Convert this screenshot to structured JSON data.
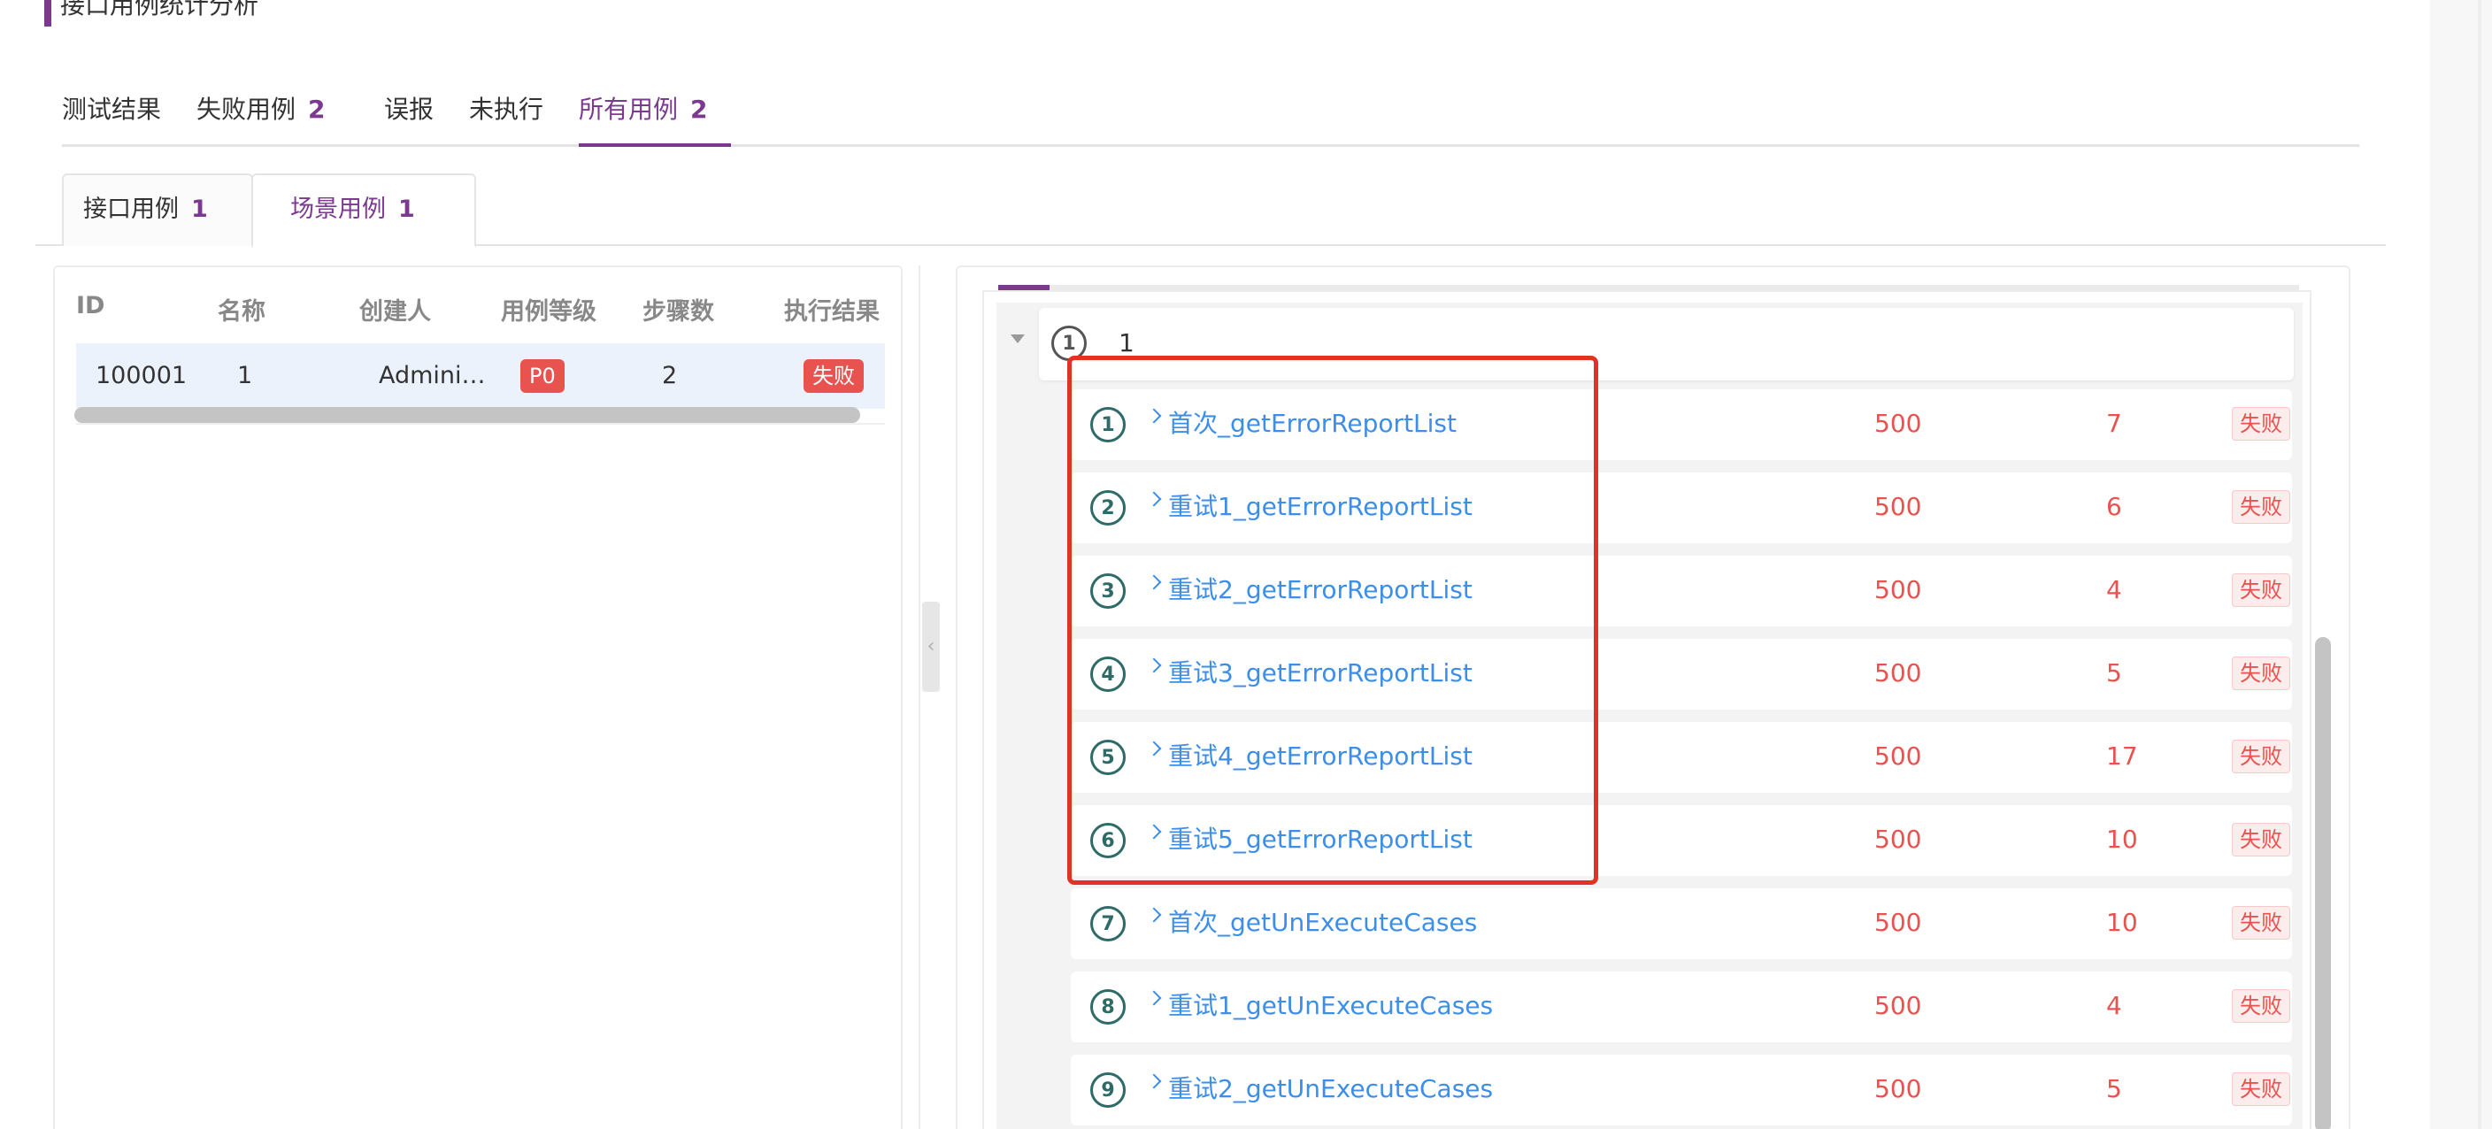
{
  "page": {
    "title": "接口用例统计分析"
  },
  "top_tabs": [
    {
      "label": "测试结果",
      "count": ""
    },
    {
      "label": "失败用例",
      "count": "2"
    },
    {
      "label": "误报",
      "count": ""
    },
    {
      "label": "未执行",
      "count": ""
    },
    {
      "label": "所有用例",
      "count": "2",
      "active": true
    }
  ],
  "sub_tabs": [
    {
      "label": "接口用例",
      "count": "1"
    },
    {
      "label": "场景用例",
      "count": "1",
      "active": true
    }
  ],
  "left_table": {
    "headers": [
      "ID",
      "名称",
      "创建人",
      "用例等级",
      "步骤数",
      "执行结果"
    ],
    "rows": [
      {
        "id": "100001",
        "name": "1",
        "creator": "Admini…",
        "level": "P0",
        "steps": "2",
        "result": "失败"
      }
    ]
  },
  "scenario": {
    "group": {
      "index": "1",
      "name": "1"
    },
    "steps": [
      {
        "index": "1",
        "name": "首次_getErrorReportList",
        "code": "500",
        "time": "7",
        "status": "失败"
      },
      {
        "index": "2",
        "name": "重试1_getErrorReportList",
        "code": "500",
        "time": "6",
        "status": "失败"
      },
      {
        "index": "3",
        "name": "重试2_getErrorReportList",
        "code": "500",
        "time": "4",
        "status": "失败"
      },
      {
        "index": "4",
        "name": "重试3_getErrorReportList",
        "code": "500",
        "time": "5",
        "status": "失败"
      },
      {
        "index": "5",
        "name": "重试4_getErrorReportList",
        "code": "500",
        "time": "17",
        "status": "失败"
      },
      {
        "index": "6",
        "name": "重试5_getErrorReportList",
        "code": "500",
        "time": "10",
        "status": "失败"
      },
      {
        "index": "7",
        "name": "首次_getUnExecuteCases",
        "code": "500",
        "time": "10",
        "status": "失败"
      },
      {
        "index": "8",
        "name": "重试1_getUnExecuteCases",
        "code": "500",
        "time": "4",
        "status": "失败"
      },
      {
        "index": "9",
        "name": "重试2_getUnExecuteCases",
        "code": "500",
        "time": "5",
        "status": "失败"
      }
    ]
  },
  "icons": {
    "collapse_handle": "chevron-left-icon",
    "group_toggle": "caret-down-icon",
    "step_expand": "chevron-right-icon"
  },
  "colors": {
    "accent": "#7b3a8f",
    "link": "#3d8ee8",
    "error": "#e8534f",
    "highlight": "#e13223"
  }
}
